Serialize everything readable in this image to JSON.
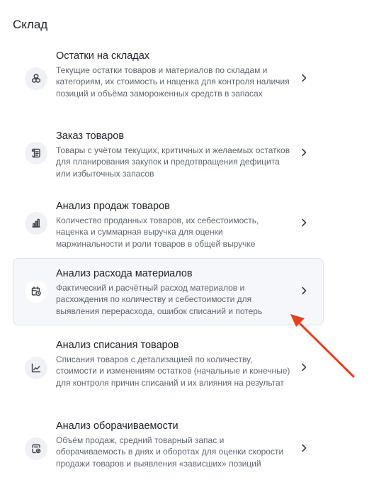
{
  "page": {
    "title": "Склад"
  },
  "colors": {
    "accent_arrow": "#e8401c",
    "active_card_bg": "#f6f7fa",
    "icon_bg": "#eff1f5"
  },
  "items": [
    {
      "title": "Остатки на складах",
      "description": "Текущие остатки товаров и материалов по складам и категориям, их стоимость и наценка для контроля наличия позиций и объёма замороженных средств в запасах",
      "icon": "boxes-stack-icon"
    },
    {
      "title": "Заказ товаров",
      "description": "Товары с учётом текущих, критичных и желаемых остатков для планирования закупок и предотвращения дефицита или избыточных запасов",
      "icon": "order-list-icon"
    },
    {
      "title": "Анализ продаж товаров",
      "description": "Количество проданных товаров, их себестоимость, наценка и суммарная выручка для оценки маржинальности и роли товаров в общей выручке",
      "icon": "bar-chart-icon"
    },
    {
      "title": "Анализ расхода материалов",
      "description": "Фактический и расчётный расход материалов и расхождения по количеству и себестоимости для выявления перерасхода, ошибок списаний и потерь",
      "icon": "calendar-clock-icon"
    },
    {
      "title": "Анализ списания товаров",
      "description": "Списания товаров с детализацией по количеству, стоимости и изменениям остатков (начальные и конечные) для контроля причин списаний и их влияния на результат",
      "icon": "line-chart-icon"
    },
    {
      "title": "Анализ оборачиваемости",
      "description": "Объём продаж, средний товарный запас и оборачиваемость в днях и оборотах для оценки скорости продажи товаров и выявления «зависших» позиций",
      "icon": "turnover-icon"
    }
  ]
}
